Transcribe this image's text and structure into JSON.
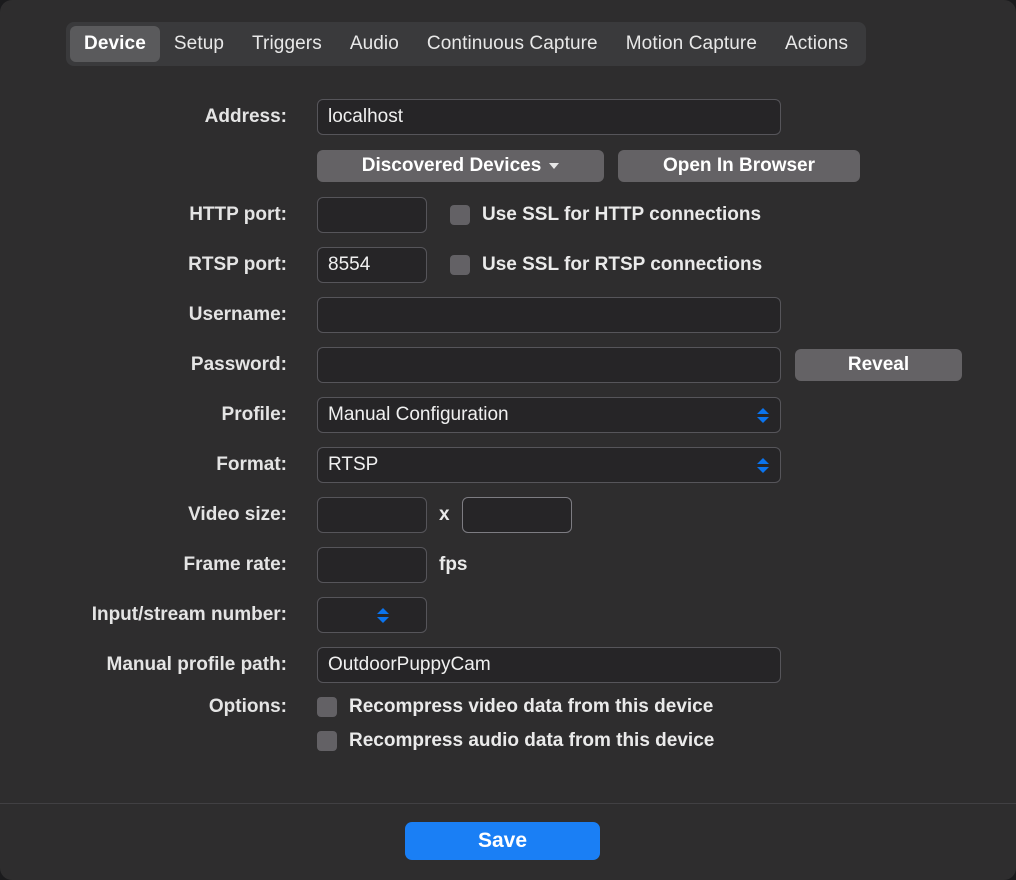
{
  "tabs": [
    {
      "label": "Device",
      "selected": true
    },
    {
      "label": "Setup",
      "selected": false
    },
    {
      "label": "Triggers",
      "selected": false
    },
    {
      "label": "Audio",
      "selected": false
    },
    {
      "label": "Continuous Capture",
      "selected": false
    },
    {
      "label": "Motion Capture",
      "selected": false
    },
    {
      "label": "Actions",
      "selected": false
    }
  ],
  "form": {
    "address": {
      "label": "Address:",
      "value": "localhost",
      "discovered_devices_label": "Discovered Devices",
      "open_in_browser_label": "Open In Browser"
    },
    "http_port": {
      "label": "HTTP port:",
      "value": "",
      "ssl_checkbox_label": "Use SSL for HTTP connections",
      "ssl_checked": false
    },
    "rtsp_port": {
      "label": "RTSP port:",
      "value": "8554",
      "ssl_checkbox_label": "Use SSL for RTSP connections",
      "ssl_checked": false
    },
    "username": {
      "label": "Username:",
      "value": ""
    },
    "password": {
      "label": "Password:",
      "value": "",
      "reveal_label": "Reveal"
    },
    "profile": {
      "label": "Profile:",
      "value": "Manual Configuration"
    },
    "format": {
      "label": "Format:",
      "value": "RTSP"
    },
    "video_size": {
      "label": "Video size:",
      "width_value": "",
      "separator": "x",
      "height_value": ""
    },
    "frame_rate": {
      "label": "Frame rate:",
      "value": "",
      "unit": "fps"
    },
    "input_stream_number": {
      "label": "Input/stream number:",
      "value": ""
    },
    "manual_profile_path": {
      "label": "Manual profile path:",
      "value": "OutdoorPuppyCam"
    },
    "options": {
      "label": "Options:",
      "items": [
        {
          "label": "Recompress video data from this device",
          "checked": false
        },
        {
          "label": "Recompress audio data from this device",
          "checked": false
        }
      ]
    }
  },
  "footer": {
    "save_label": "Save"
  },
  "colors": {
    "window_background": "#2e2d2e",
    "tabbar_background": "#3a3a3c",
    "selected_tab": "#5a5a5c",
    "field_background": "#262527",
    "field_border": "#56555a",
    "accent_blue": "#1a7ff5",
    "chevron_blue": "#0b74ee",
    "button_gray": "#646265",
    "checkbox_gray": "#636165"
  }
}
